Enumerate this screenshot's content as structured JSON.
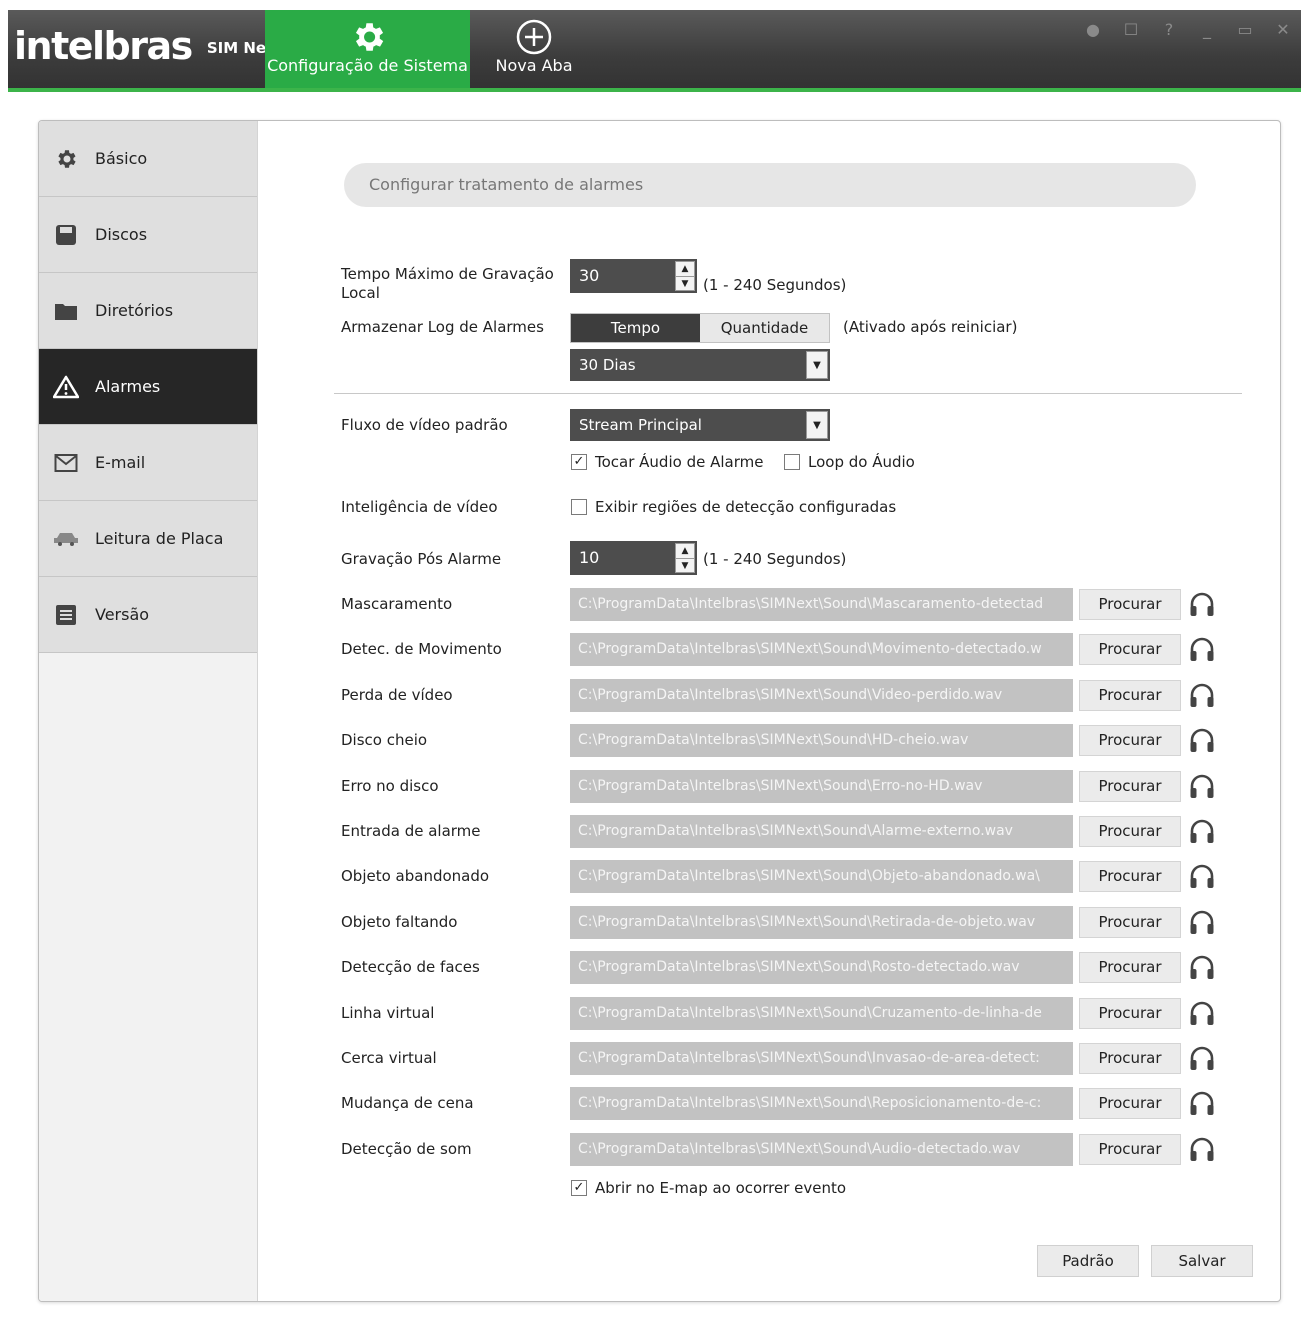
{
  "app": {
    "brand": "intelbras",
    "product": "SIM Next"
  },
  "tabs": [
    {
      "label": "Configuração de Sistema",
      "icon": "gear-icon",
      "active": true
    },
    {
      "label": "Nova Aba",
      "icon": "plus-circle-icon",
      "active": false
    }
  ],
  "window_controls": [
    "user-icon",
    "lock-icon",
    "help-icon",
    "minimize-icon",
    "maximize-icon",
    "close-icon"
  ],
  "sidebar": {
    "items": [
      {
        "label": "Básico",
        "icon": "gear-icon"
      },
      {
        "label": "Discos",
        "icon": "disk-icon"
      },
      {
        "label": "Diretórios",
        "icon": "folder-icon"
      },
      {
        "label": "Alarmes",
        "icon": "warning-icon",
        "active": true
      },
      {
        "label": "E-mail",
        "icon": "mail-icon"
      },
      {
        "label": "Leitura de Placa",
        "icon": "car-icon"
      },
      {
        "label": "Versão",
        "icon": "list-icon"
      }
    ]
  },
  "main": {
    "header": "Configurar tratamento de alarmes",
    "max_record": {
      "label": "Tempo Máximo de Gravação Local",
      "value": "30",
      "hint": "(1 - 240 Segundos)"
    },
    "log": {
      "label": "Armazenar Log de Alarmes",
      "options": [
        "Tempo",
        "Quantidade"
      ],
      "selected": "Tempo",
      "hint": "(Ativado após reiniciar)",
      "duration": "30 Dias"
    },
    "stream": {
      "label": "Fluxo de vídeo padrão",
      "value": "Stream Principal"
    },
    "play_alarm_audio": {
      "label": "Tocar Áudio de Alarme",
      "checked": true
    },
    "loop_audio": {
      "label": "Loop do Áudio",
      "checked": false
    },
    "video_intel": {
      "label": "Inteligência de vídeo",
      "option": "Exibir regiões de detecção configuradas",
      "checked": false
    },
    "post_alarm": {
      "label": "Gravação Pós Alarme",
      "value": "10",
      "hint": "(1 - 240 Segundos)"
    },
    "browse_label": "Procurar",
    "sounds": [
      {
        "label": "Mascaramento",
        "path": "C:\\ProgramData\\Intelbras\\SIMNext\\Sound\\Mascaramento-detectad"
      },
      {
        "label": "Detec. de Movimento",
        "path": "C:\\ProgramData\\Intelbras\\SIMNext\\Sound\\Movimento-detectado.w"
      },
      {
        "label": "Perda de vídeo",
        "path": "C:\\ProgramData\\Intelbras\\SIMNext\\Sound\\Video-perdido.wav"
      },
      {
        "label": "Disco cheio",
        "path": "C:\\ProgramData\\Intelbras\\SIMNext\\Sound\\HD-cheio.wav"
      },
      {
        "label": "Erro no disco",
        "path": "C:\\ProgramData\\Intelbras\\SIMNext\\Sound\\Erro-no-HD.wav"
      },
      {
        "label": "Entrada de alarme",
        "path": "C:\\ProgramData\\Intelbras\\SIMNext\\Sound\\Alarme-externo.wav"
      },
      {
        "label": "Objeto abandonado",
        "path": "C:\\ProgramData\\Intelbras\\SIMNext\\Sound\\Objeto-abandonado.wa\\"
      },
      {
        "label": "Objeto faltando",
        "path": "C:\\ProgramData\\Intelbras\\SIMNext\\Sound\\Retirada-de-objeto.wav"
      },
      {
        "label": "Detecção de faces",
        "path": "C:\\ProgramData\\Intelbras\\SIMNext\\Sound\\Rosto-detectado.wav"
      },
      {
        "label": "Linha virtual",
        "path": "C:\\ProgramData\\Intelbras\\SIMNext\\Sound\\Cruzamento-de-linha-de"
      },
      {
        "label": "Cerca virtual",
        "path": "C:\\ProgramData\\Intelbras\\SIMNext\\Sound\\Invasao-de-area-detect:"
      },
      {
        "label": "Mudança de cena",
        "path": "C:\\ProgramData\\Intelbras\\SIMNext\\Sound\\Reposicionamento-de-c:"
      },
      {
        "label": "Detecção de som",
        "path": "C:\\ProgramData\\Intelbras\\SIMNext\\Sound\\Audio-detectado.wav"
      }
    ],
    "emap": {
      "label": "Abrir no E-map ao ocorrer evento",
      "checked": true
    },
    "default_button": "Padrão",
    "save_button": "Salvar"
  },
  "colors": {
    "accent": "#2aab46",
    "titlebar": "#3c3c3c",
    "active_nav": "#262626"
  }
}
